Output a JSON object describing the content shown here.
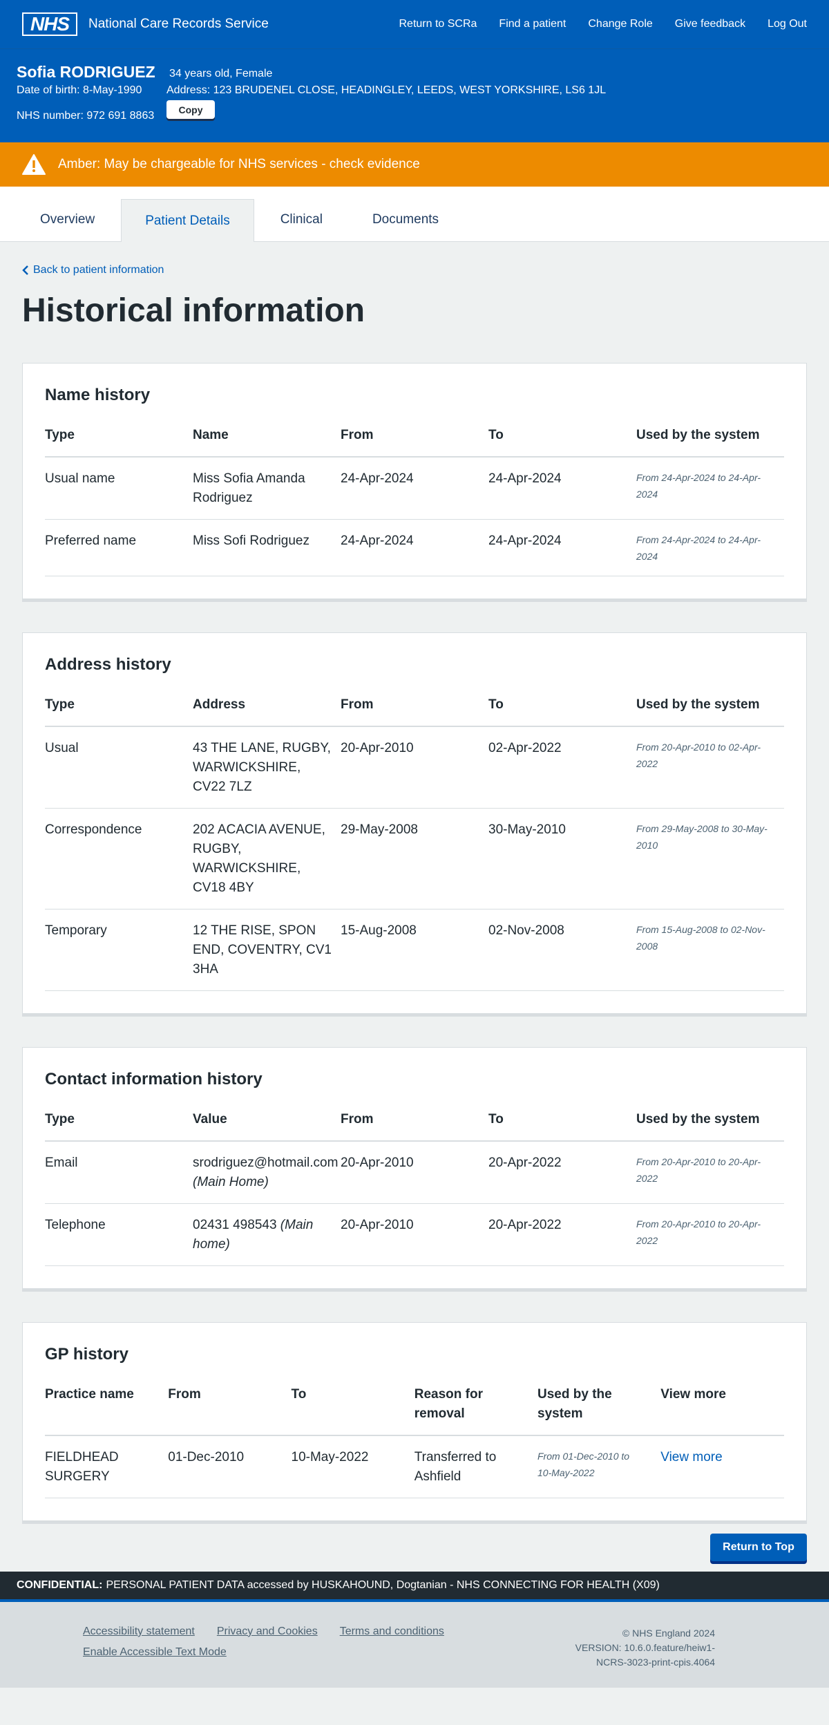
{
  "header": {
    "logo": "NHS",
    "service_name": "National Care Records Service",
    "nav": [
      "Return to SCRa",
      "Find a patient",
      "Change Role",
      "Give feedback",
      "Log Out"
    ]
  },
  "patient": {
    "name": "Sofia RODRIGUEZ",
    "age_gender": "34 years old, Female",
    "dob": "Date of birth: 8-May-1990",
    "address": "Address: 123 BRUDENEL CLOSE, HEADINGLEY, LEEDS, WEST YORKSHIRE, LS6 1JL",
    "nhs_number": "NHS number: 972 691 8863",
    "copy_label": "Copy"
  },
  "alert": {
    "text": "Amber: May be chargeable for NHS services - check evidence",
    "color": "#ED8B00",
    "icon": "warning-icon"
  },
  "tabs": [
    "Overview",
    "Patient Details",
    "Clinical",
    "Documents"
  ],
  "active_tab": "Patient Details",
  "back_link": "Back to patient information",
  "page_title": "Historical information",
  "name_history": {
    "title": "Name history",
    "headers": [
      "Type",
      "Name",
      "From",
      "To",
      "Used by the system"
    ],
    "rows": [
      {
        "type": "Usual name",
        "name": "Miss Sofia Amanda Rodriguez",
        "from": "24-Apr-2024",
        "to": "24-Apr-2024",
        "used": "From 24-Apr-2024 to 24-Apr-2024"
      },
      {
        "type": "Preferred name",
        "name": "Miss Sofi Rodriguez",
        "from": "24-Apr-2024",
        "to": "24-Apr-2024",
        "used": "From 24-Apr-2024 to 24-Apr-2024"
      }
    ]
  },
  "address_history": {
    "title": "Address history",
    "headers": [
      "Type",
      "Address",
      "From",
      "To",
      "Used by the system"
    ],
    "rows": [
      {
        "type": "Usual",
        "address": "43 THE LANE, RUGBY, WARWICKSHIRE, CV22 7LZ",
        "from": "20-Apr-2010",
        "to": "02-Apr-2022",
        "used": "From 20-Apr-2010 to 02-Apr-2022"
      },
      {
        "type": "Correspondence",
        "address": "202 ACACIA AVENUE, RUGBY, WARWICKSHIRE, CV18 4BY",
        "from": "29-May-2008",
        "to": "30-May-2010",
        "used": "From 29-May-2008 to 30-May-2010"
      },
      {
        "type": "Temporary",
        "address": "12 THE RISE, SPON END, COVENTRY, CV1 3HA",
        "from": "15-Aug-2008",
        "to": "02-Nov-2008",
        "used": "From 15-Aug-2008 to 02-Nov-2008"
      }
    ]
  },
  "contact_history": {
    "title": "Contact information history",
    "headers": [
      "Type",
      "Value",
      "From",
      "To",
      "Used by the system"
    ],
    "rows": [
      {
        "type": "Email",
        "value": "srodriguez@hotmail.com",
        "qualifier": "(Main Home)",
        "from": "20-Apr-2010",
        "to": "20-Apr-2022",
        "used": "From 20-Apr-2010 to 20-Apr-2022"
      },
      {
        "type": "Telephone",
        "value": "02431 498543",
        "qualifier": "(Main home)",
        "from": "20-Apr-2010",
        "to": "20-Apr-2022",
        "used": "From 20-Apr-2010 to 20-Apr-2022"
      }
    ]
  },
  "gp_history": {
    "title": "GP history",
    "headers": [
      "Practice name",
      "From",
      "To",
      "Reason for removal",
      "Used by the system",
      "View more"
    ],
    "rows": [
      {
        "practice": "FIELDHEAD SURGERY",
        "from": "01-Dec-2010",
        "to": "10-May-2022",
        "reason": "Transferred to Ashfield",
        "used": "From 01-Dec-2010 to 10-May-2022",
        "link": "View more"
      }
    ]
  },
  "return_to_top": "Return to Top",
  "confidential": {
    "label": "CONFIDENTIAL:",
    "text": "PERSONAL PATIENT DATA accessed by HUSKAHOUND, Dogtanian - NHS CONNECTING FOR HEALTH (X09)"
  },
  "footer": {
    "links": [
      "Accessibility statement",
      "Privacy and Cookies",
      "Terms and conditions",
      "Enable Accessible Text Mode"
    ],
    "copyright": "© NHS England 2024",
    "version_line1": "VERSION: 10.6.0.feature/heiw1-",
    "version_line2": "NCRS-3023-print-cpis.4064"
  }
}
